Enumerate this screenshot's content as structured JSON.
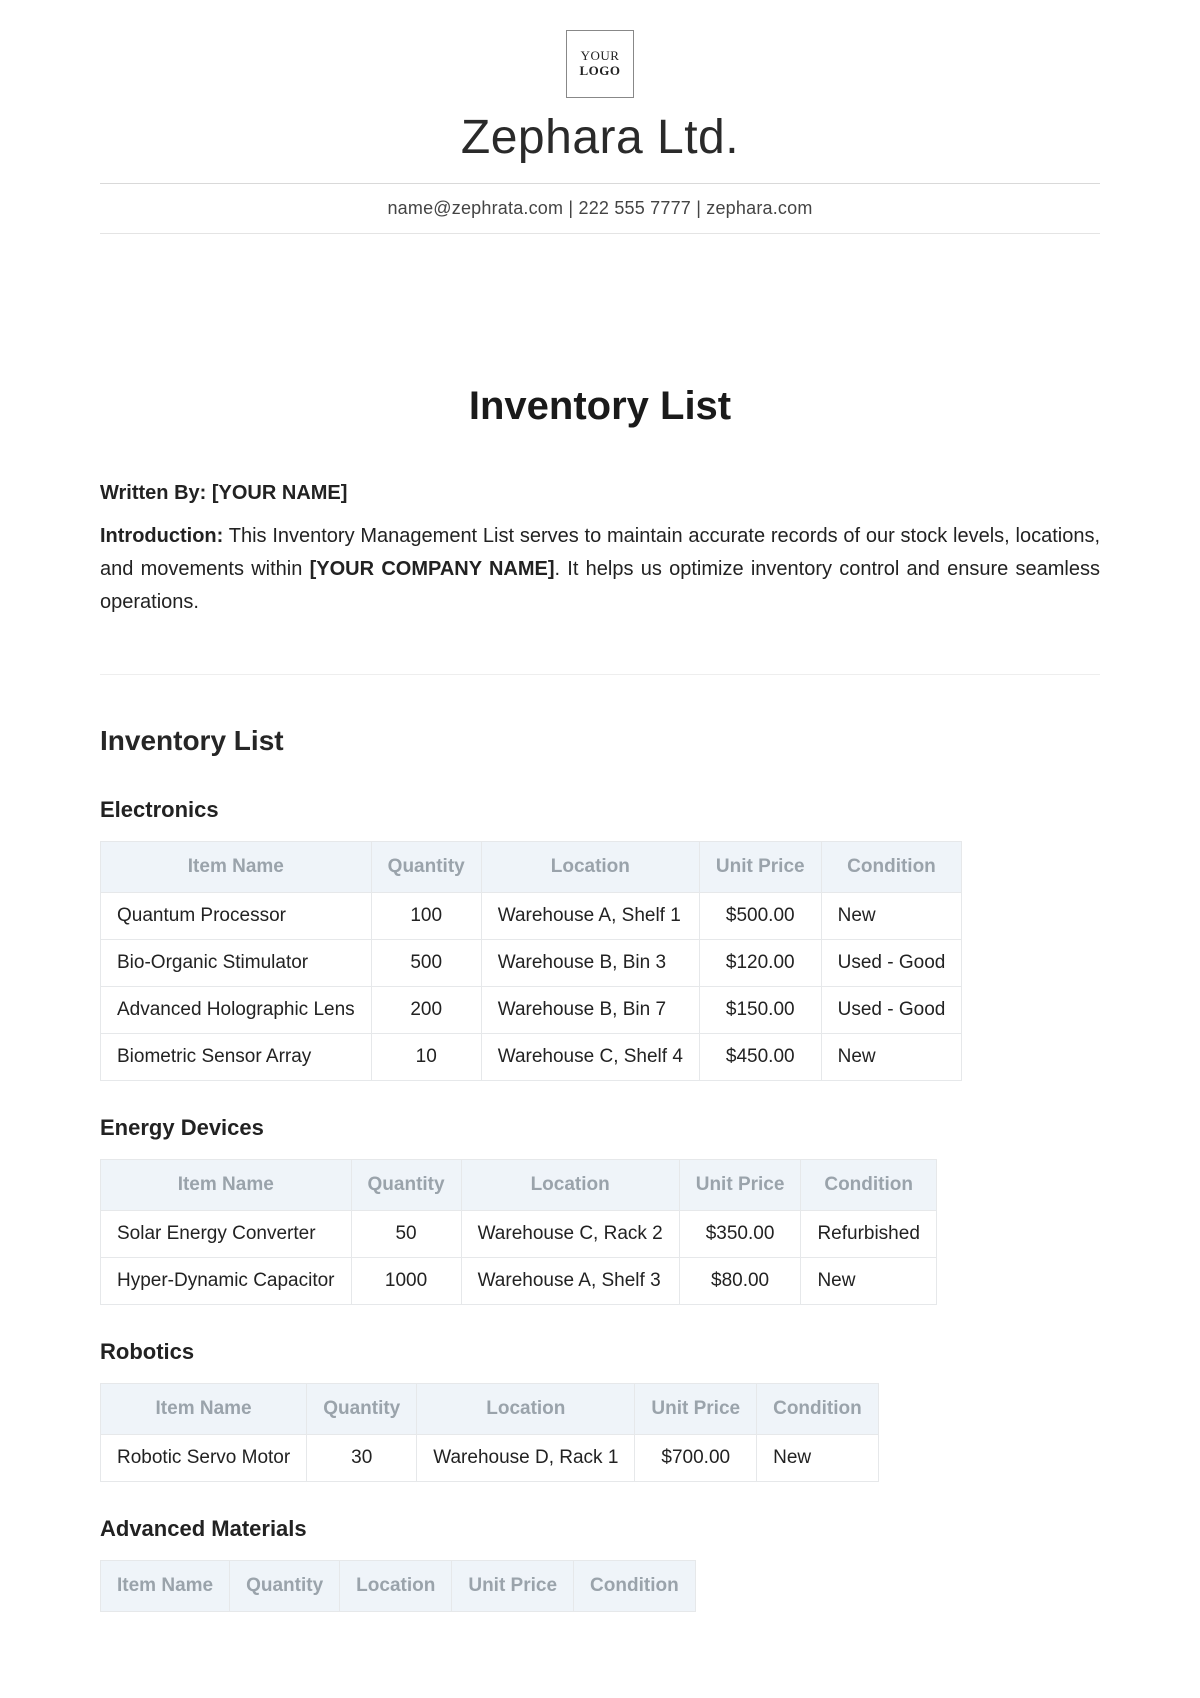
{
  "header": {
    "logo_line1": "YOUR",
    "logo_line2": "LOGO",
    "company_name": "Zephara Ltd.",
    "contact_line": "name@zephrata.com | 222 555 7777 | zephara.com"
  },
  "document": {
    "title": "Inventory List",
    "written_by_label": "Written By:",
    "written_by_value": "[YOUR NAME]",
    "intro_label": "Introduction:",
    "intro_part1": " This Inventory Management List serves to maintain accurate records of our stock levels, locations, and movements within ",
    "intro_company_token": "[YOUR COMPANY NAME]",
    "intro_part2": ". It helps us optimize inventory control and ensure seamless operations."
  },
  "section_heading": "Inventory List",
  "columns": {
    "item": "Item Name",
    "qty": "Quantity",
    "loc": "Location",
    "price": "Unit Price",
    "cond": "Condition"
  },
  "categories": [
    {
      "name": "Electronics",
      "rows": [
        {
          "item": "Quantum Processor",
          "qty": "100",
          "loc": "Warehouse A, Shelf 1",
          "price": "$500.00",
          "cond": "New"
        },
        {
          "item": "Bio-Organic Stimulator",
          "qty": "500",
          "loc": "Warehouse B, Bin 3",
          "price": "$120.00",
          "cond": "Used - Good"
        },
        {
          "item": "Advanced Holographic Lens",
          "qty": "200",
          "loc": "Warehouse B, Bin 7",
          "price": "$150.00",
          "cond": "Used - Good"
        },
        {
          "item": "Biometric Sensor Array",
          "qty": "10",
          "loc": "Warehouse C, Shelf 4",
          "price": "$450.00",
          "cond": "New"
        }
      ]
    },
    {
      "name": "Energy Devices",
      "rows": [
        {
          "item": "Solar Energy Converter",
          "qty": "50",
          "loc": "Warehouse C, Rack 2",
          "price": "$350.00",
          "cond": "Refurbished"
        },
        {
          "item": "Hyper-Dynamic Capacitor",
          "qty": "1000",
          "loc": "Warehouse A, Shelf 3",
          "price": "$80.00",
          "cond": "New"
        }
      ]
    },
    {
      "name": "Robotics",
      "rows": [
        {
          "item": "Robotic Servo Motor",
          "qty": "30",
          "loc": "Warehouse D, Rack 1",
          "price": "$700.00",
          "cond": "New"
        }
      ]
    },
    {
      "name": "Advanced Materials",
      "rows": []
    }
  ]
}
